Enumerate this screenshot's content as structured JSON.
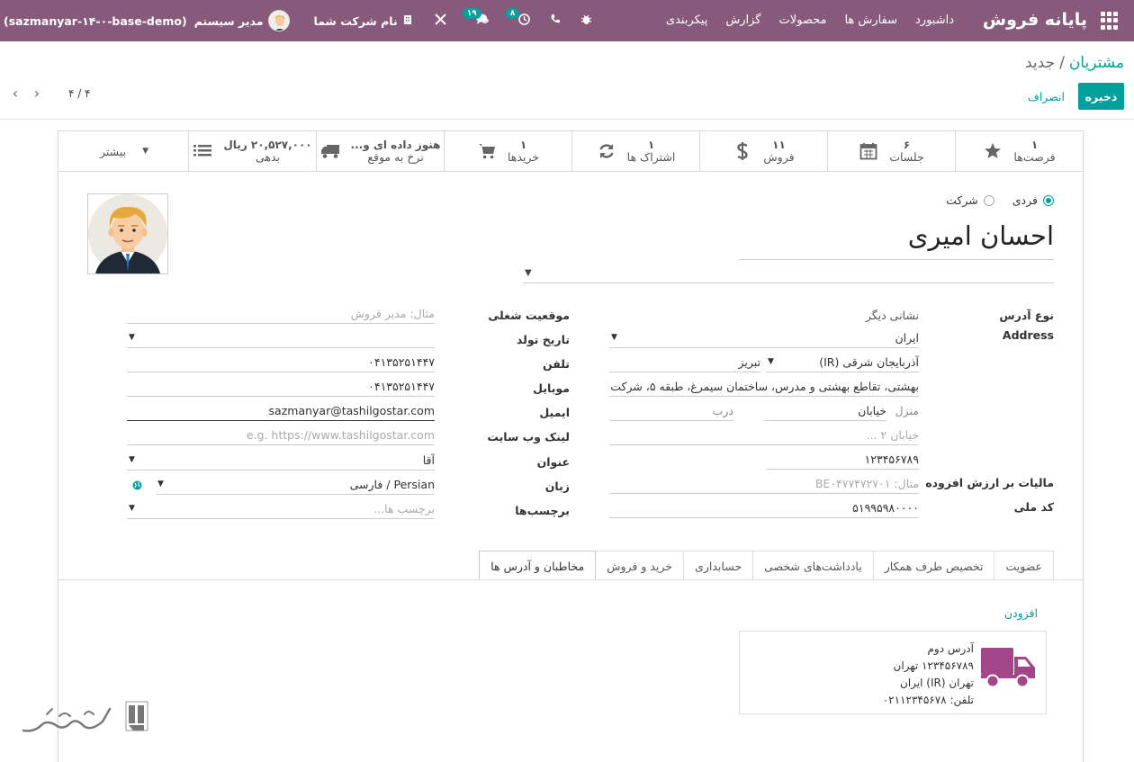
{
  "navbar": {
    "brand": "پایانه فروش",
    "menu": [
      "داشبورد",
      "سفارش ها",
      "محصولات",
      "گزارش",
      "پیکربندی"
    ],
    "db_name": "(sazmanyar-۱۴-۰-base-demo)",
    "user_name": "مدیر سیستم",
    "company": "نام شرکت شما",
    "messages_badge": "۱۹",
    "activities_badge": "۸",
    "icons": [
      "bug-icon",
      "phone-icon",
      "clock-icon",
      "chat-icon",
      "tools-icon"
    ]
  },
  "breadcrumb": {
    "parent": "مشتریان",
    "separator": "/",
    "current": "جدید"
  },
  "actions": {
    "save": "ذخیره",
    "discard": "انصراف"
  },
  "pager": {
    "value": "۴ / ۴"
  },
  "smart_buttons": [
    {
      "value": "۱",
      "label": "فرصت‌ها",
      "icon": "star-icon"
    },
    {
      "value": "۶",
      "label": "جلسات",
      "icon": "calendar-icon"
    },
    {
      "value": "۱۱",
      "label": "فروش",
      "icon": "dollar-icon"
    },
    {
      "value": "۱",
      "label": "اشتراک ها",
      "icon": "refresh-icon"
    },
    {
      "value": "۱",
      "label": "خریدها",
      "icon": "cart-icon"
    },
    {
      "value": "هنوز داده ای و...",
      "label": "نرخ به موقع",
      "icon": "truck-icon"
    },
    {
      "value": "۲۰,۵۲۷,۰۰۰ ریال",
      "label": "بدهی",
      "icon": "list-icon"
    }
  ],
  "more_label": "بیشتر",
  "company_type": {
    "individual": "فردی",
    "company": "شرکت",
    "selected": "individual"
  },
  "partner": {
    "name": "احسان امیری"
  },
  "address": {
    "type_label": "نوع آدرس",
    "type_value": "نشانی دیگر",
    "address_label": "Address",
    "country": "ایران",
    "state": "آذربایجان شرقی (IR)",
    "city": "تبریز",
    "street": "بهشتی، تقاطع بهشتی و مدرس، ساختمان سیمرغ، طبقه ۵، شرکت",
    "house_label": "منزل",
    "house_value": "خیابان",
    "door_label": "درب",
    "street2_placeholder": "خیابان ۲ ...",
    "zip": "۱۲۳۴۵۶۷۸۹"
  },
  "vat": {
    "label": "مالیات بر ارزش افزوده",
    "placeholder": "مثال: BE۰۴۷۷۴۷۲۷۰۱"
  },
  "national_id": {
    "label": "کد ملی",
    "value": "۵۱۹۹۵۹۸۰۰۰۰"
  },
  "right_fields": {
    "job_label": "موقعیت شغلی",
    "job_placeholder": "مثال: مدیر فروش",
    "birthday_label": "تاریخ تولد",
    "phone_label": "تلفن",
    "phone_value": "۰۴۱۳۵۲۵۱۴۴۷",
    "mobile_label": "موبایل",
    "mobile_value": "۰۴۱۳۵۲۵۱۴۴۷",
    "email_label": "ایمیل",
    "email_value": "sazmanyar@tashilgostar.com",
    "website_label": "لینک وب سایت",
    "website_placeholder": "e.g. https://www.tashilgostar.com",
    "title_label": "عنوان",
    "title_value": "آقا",
    "lang_label": "زبان",
    "lang_value": "Persian / فارسی",
    "tags_label": "برچسب‌ها",
    "tags_placeholder": "برچسب ها..."
  },
  "tabs": [
    "مخاطبان و آدرس ها",
    "خرید و فروش",
    "حسابداری",
    "یادداشت‌های شخصی",
    "تخصیص طرف همکار",
    "عضویت"
  ],
  "add_label": "افزودن",
  "contact_card": {
    "lines": [
      "آدرس دوم",
      "۱۲۳۴۵۶۷۸۹ تهران",
      "تهران (IR) ایران",
      "تلفن: ۰۲۱۱۲۳۴۵۶۷۸"
    ],
    "icon_color": "#a24689"
  },
  "colors": {
    "navbar": "#875a7b",
    "accent": "#00a09d"
  }
}
